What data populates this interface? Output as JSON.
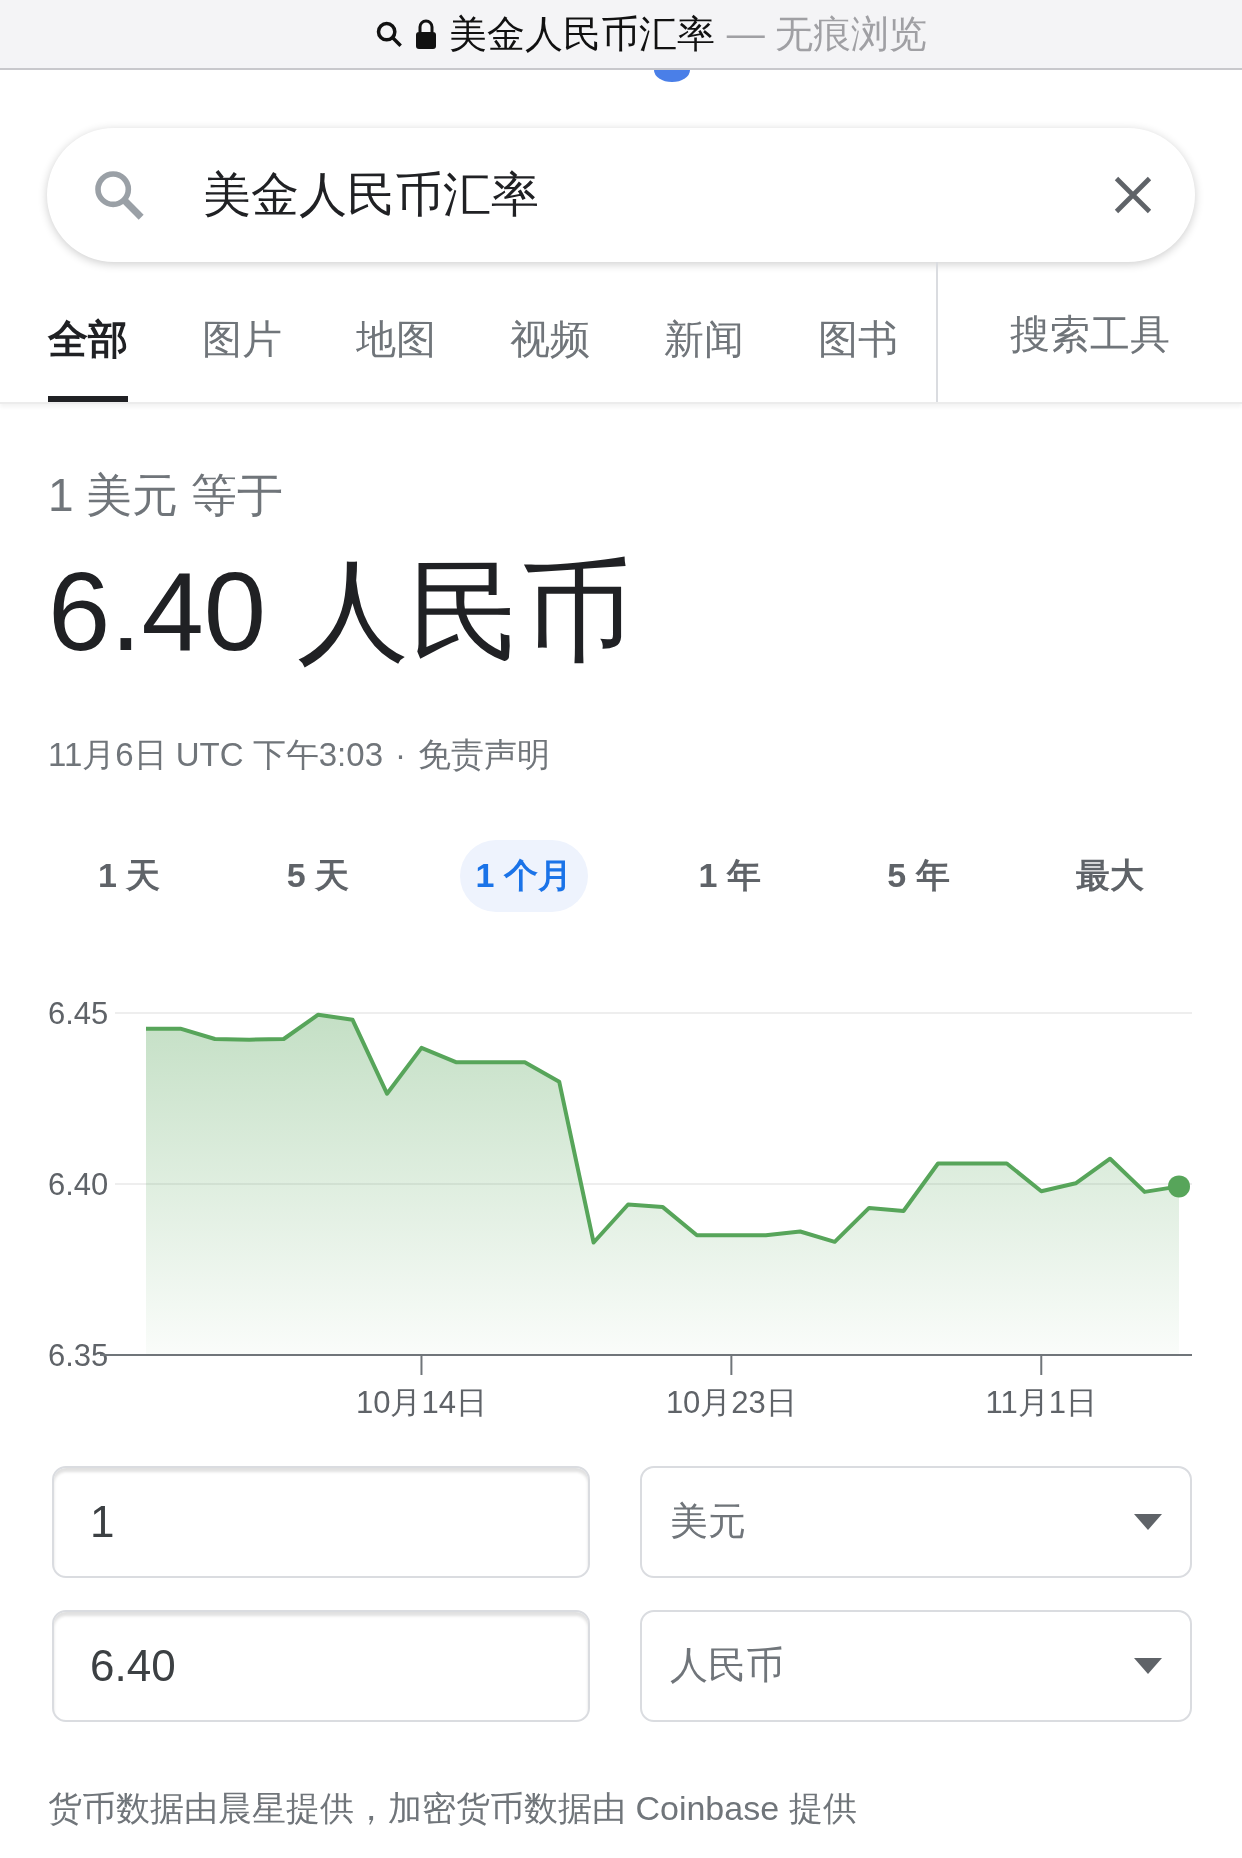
{
  "browser_bar": {
    "title": "美金人民币汇率",
    "suffix": "— 无痕浏览"
  },
  "search": {
    "value": "美金人民币汇率"
  },
  "tabs": [
    {
      "label": "全部",
      "selected": true
    },
    {
      "label": "图片",
      "selected": false
    },
    {
      "label": "地图",
      "selected": false
    },
    {
      "label": "视频",
      "selected": false
    },
    {
      "label": "新闻",
      "selected": false
    },
    {
      "label": "图书",
      "selected": false
    }
  ],
  "tools_button": "搜索工具",
  "converter": {
    "equals_label": "1 美元 等于",
    "result": "6.40 人民币",
    "timestamp": "11月6日 UTC 下午3:03",
    "separator": "·",
    "disclaimer": "免责声明",
    "ranges": [
      {
        "label": "1 天",
        "selected": false
      },
      {
        "label": "5 天",
        "selected": false
      },
      {
        "label": "1 个月",
        "selected": true
      },
      {
        "label": "1 年",
        "selected": false
      },
      {
        "label": "5 年",
        "selected": false
      },
      {
        "label": "最大",
        "selected": false
      }
    ],
    "chart_data": {
      "type": "area",
      "categories": [
        null,
        null,
        null,
        null,
        null,
        null,
        null,
        null,
        "10月14日",
        null,
        null,
        null,
        null,
        null,
        null,
        null,
        null,
        "10月23日",
        null,
        null,
        null,
        null,
        null,
        null,
        null,
        null,
        "11月1日",
        null,
        null,
        null,
        null
      ],
      "series": [
        {
          "color": "#57a55a",
          "values": [
            6.4454,
            6.4454,
            6.4424,
            6.4422,
            6.4424,
            6.4495,
            6.448,
            6.4264,
            6.4398,
            6.4356,
            6.4356,
            6.4356,
            6.4299,
            6.3829,
            6.394,
            6.3933,
            6.385,
            6.385,
            6.385,
            6.3861,
            6.3831,
            6.393,
            6.3921,
            6.406,
            6.406,
            6.406,
            6.3979,
            6.4002,
            6.4074,
            6.3977,
            6.3993
          ]
        }
      ],
      "ylim": [
        6.35,
        6.45
      ],
      "yticks": [
        {
          "value": 6.35,
          "label": "6.35"
        },
        {
          "value": 6.4,
          "label": "6.40"
        },
        {
          "value": 6.45,
          "label": "6.45"
        }
      ]
    },
    "fields": [
      {
        "kind": "input",
        "value": "1"
      },
      {
        "kind": "select",
        "value": "美元"
      },
      {
        "kind": "input",
        "value": "6.40"
      },
      {
        "kind": "select",
        "value": "人民币"
      }
    ],
    "footer": "货币数据由晨星提供，加密货币数据由 Coinbase 提供"
  }
}
